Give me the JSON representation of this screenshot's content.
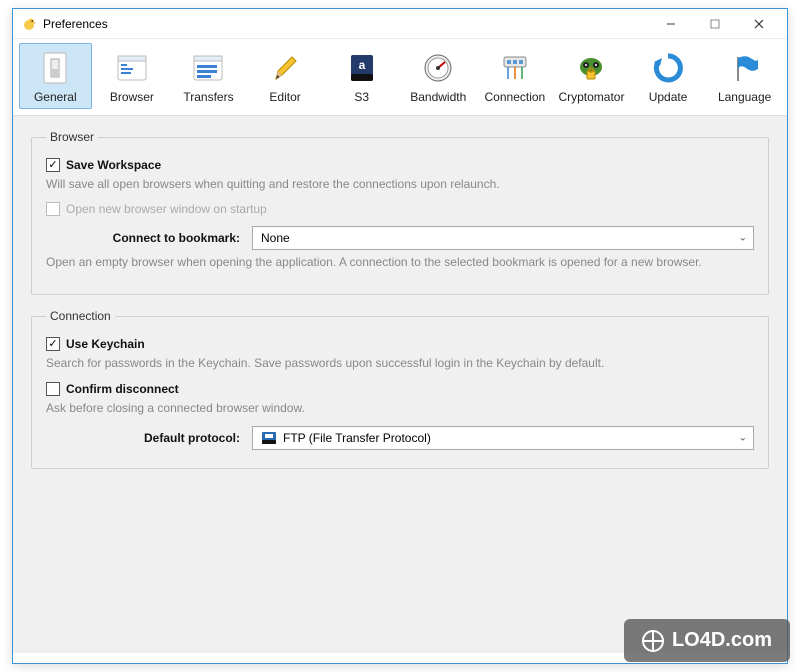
{
  "window": {
    "title": "Preferences"
  },
  "toolbar": {
    "items": [
      {
        "id": "general",
        "label": "General",
        "selected": true
      },
      {
        "id": "browser",
        "label": "Browser",
        "selected": false
      },
      {
        "id": "transfers",
        "label": "Transfers",
        "selected": false
      },
      {
        "id": "editor",
        "label": "Editor",
        "selected": false
      },
      {
        "id": "s3",
        "label": "S3",
        "selected": false
      },
      {
        "id": "bandwidth",
        "label": "Bandwidth",
        "selected": false
      },
      {
        "id": "connection",
        "label": "Connection",
        "selected": false
      },
      {
        "id": "cryptomator",
        "label": "Cryptomator",
        "selected": false
      },
      {
        "id": "update",
        "label": "Update",
        "selected": false
      },
      {
        "id": "language",
        "label": "Language",
        "selected": false
      }
    ]
  },
  "groups": {
    "browser": {
      "legend": "Browser",
      "save_workspace": {
        "label": "Save Workspace",
        "checked": true,
        "desc": "Will save all open browsers when quitting and restore the connections upon relaunch."
      },
      "open_new_window": {
        "label": "Open new browser window on startup",
        "checked": false,
        "disabled": true
      },
      "connect_bookmark": {
        "label": "Connect to bookmark:",
        "value": "None",
        "desc": "Open an empty browser when opening the application. A connection to the selected bookmark is opened for a new browser."
      }
    },
    "connection": {
      "legend": "Connection",
      "use_keychain": {
        "label": "Use Keychain",
        "checked": true,
        "desc": "Search for passwords in the Keychain. Save passwords upon successful login in the Keychain by default."
      },
      "confirm_disconnect": {
        "label": "Confirm disconnect",
        "checked": false,
        "desc": "Ask before closing a connected browser window."
      },
      "default_protocol": {
        "label": "Default protocol:",
        "value": "FTP (File Transfer Protocol)"
      }
    }
  },
  "watermark": "LO4D.com"
}
